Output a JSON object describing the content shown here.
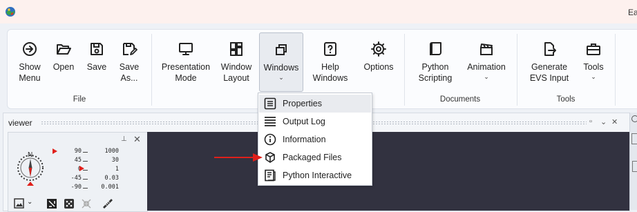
{
  "window": {
    "title": "Ea"
  },
  "ribbon": {
    "groups": [
      {
        "name": "File"
      },
      {
        "name": "Documents"
      },
      {
        "name": "Tools"
      }
    ],
    "buttons": [
      {
        "label": "Show\nMenu",
        "icon": "arrow-circle-right-icon"
      },
      {
        "label": "Open",
        "icon": "folder-open-icon"
      },
      {
        "label": "Save",
        "icon": "floppy-disk-icon"
      },
      {
        "label": "Save\nAs...",
        "icon": "save-as-icon"
      },
      {
        "label": "Presentation\nMode",
        "icon": "monitor-icon"
      },
      {
        "label": "Window\nLayout",
        "icon": "layout-grid-icon",
        "dropdown": true
      },
      {
        "label": "Windows",
        "icon": "windows-stack-icon",
        "dropdown": true,
        "active": true
      },
      {
        "label": "Help\nWindows",
        "icon": "help-box-icon",
        "dropdown": true
      },
      {
        "label": "Options",
        "icon": "gear-icon"
      },
      {
        "label": "Python\nScripting",
        "icon": "script-icon",
        "dropdown": true
      },
      {
        "label": "Animation",
        "icon": "clapperboard-icon",
        "dropdown": true
      },
      {
        "label": "Generate\nEVS Input",
        "icon": "file-export-icon",
        "dropdown": true
      },
      {
        "label": "Tools",
        "icon": "toolbox-icon",
        "dropdown": true
      }
    ],
    "caret": "⌄"
  },
  "viewer": {
    "title": "viewer",
    "scale_rows": [
      {
        "a": "90",
        "b": "1000"
      },
      {
        "a": "45",
        "b": "30"
      },
      {
        "a": "0",
        "b": "1"
      },
      {
        "a": "-45",
        "b": "0.03"
      },
      {
        "a": "-90",
        "b": "0.001"
      }
    ],
    "compass_label": "N"
  },
  "windows_menu": {
    "items": [
      {
        "label": "Properties",
        "icon": "properties-icon",
        "highlighted": true
      },
      {
        "label": "Output Log",
        "icon": "output-log-icon"
      },
      {
        "label": "Information",
        "icon": "information-icon"
      },
      {
        "label": "Packaged Files",
        "icon": "package-icon"
      },
      {
        "label": "Python Interactive",
        "icon": "python-interactive-icon"
      }
    ]
  },
  "colors": {
    "accent_red": "#e0201b",
    "viewport_bg": "#323240",
    "menu_highlight": "#e9ebef"
  }
}
